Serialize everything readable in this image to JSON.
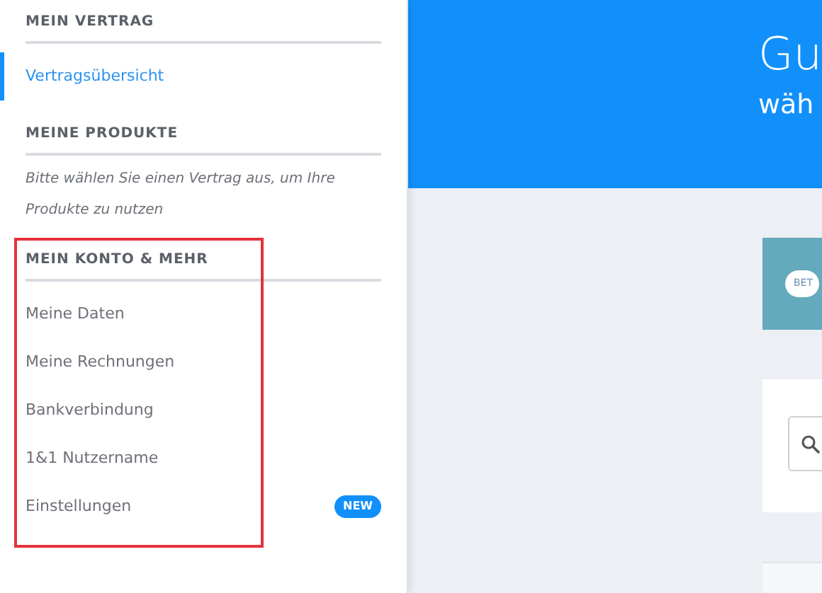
{
  "sidebar": {
    "sections": [
      {
        "heading": "MEIN VERTRAG",
        "highlighted": false,
        "items": [
          {
            "label": "Vertragsübersicht",
            "selected": true
          }
        ]
      },
      {
        "heading": "MEINE PRODUKTE",
        "highlighted": false,
        "note": "Bitte wählen Sie einen Vertrag aus, um Ihre Produkte zu nutzen"
      },
      {
        "heading": "MEIN KONTO & MEHR",
        "highlighted": true,
        "items": [
          {
            "label": "Meine Daten",
            "selected": false
          },
          {
            "label": "Meine Rechnungen",
            "selected": false
          },
          {
            "label": "Bankverbindung",
            "selected": false
          },
          {
            "label": "1&1 Nutzername",
            "selected": false
          },
          {
            "label": "Einstellungen",
            "selected": false,
            "badge": "NEW"
          }
        ]
      }
    ]
  },
  "header": {
    "title": "Gu",
    "subtitle": "wäh"
  },
  "beta_card": {
    "badge": "BET"
  }
}
